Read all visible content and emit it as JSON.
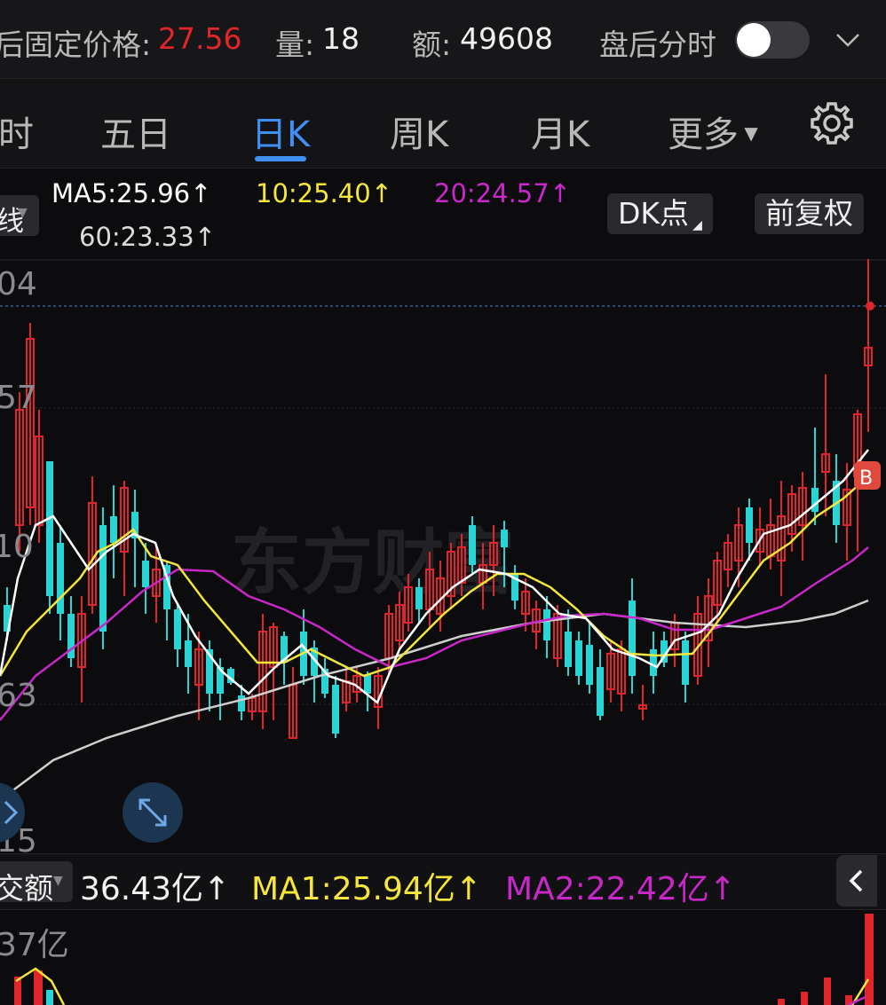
{
  "topbar": {
    "after_hours_label": "后固定价格:",
    "after_hours_price": "27.56",
    "volume_label": "量:",
    "volume_value": "18",
    "amount_label": "额:",
    "amount_value": "49608",
    "intraday_label": "盘后分时"
  },
  "tabs": [
    {
      "label": "时"
    },
    {
      "label": "五日"
    },
    {
      "label": "日K"
    },
    {
      "label": "周K"
    },
    {
      "label": "月K"
    },
    {
      "label": "更多"
    }
  ],
  "indicators": {
    "main_type": "线",
    "ma5": "MA5:25.96↑",
    "ma10": "10:25.40↑",
    "ma20": "20:24.57↑",
    "ma60": "60:23.33↑",
    "dk_button": "DK点",
    "adjust_button": "前复权"
  },
  "chart_axis": {
    "top": "04",
    "mid1": "57",
    "mid2": "10",
    "mid3": "63",
    "bottom": "15",
    "watermark": "东方财富",
    "marker": "B"
  },
  "volume": {
    "type_label": "交额",
    "value": "36.43亿↑",
    "ma1": "MA1:25.94亿↑",
    "ma2": "MA2:22.42亿↑",
    "axis_top": "37亿"
  },
  "colors": {
    "up": "#e0262b",
    "down": "#2ad4d4",
    "ma5": "#ffffff",
    "ma10": "#f5e63b",
    "ma20": "#c927c9",
    "ma60": "#cfcfcf",
    "accent": "#3f8ff5"
  },
  "chart_data": {
    "type": "candlestick",
    "x_labels": [],
    "y_ticks": [
      "04",
      "57",
      "10",
      "63",
      "15"
    ]
  }
}
